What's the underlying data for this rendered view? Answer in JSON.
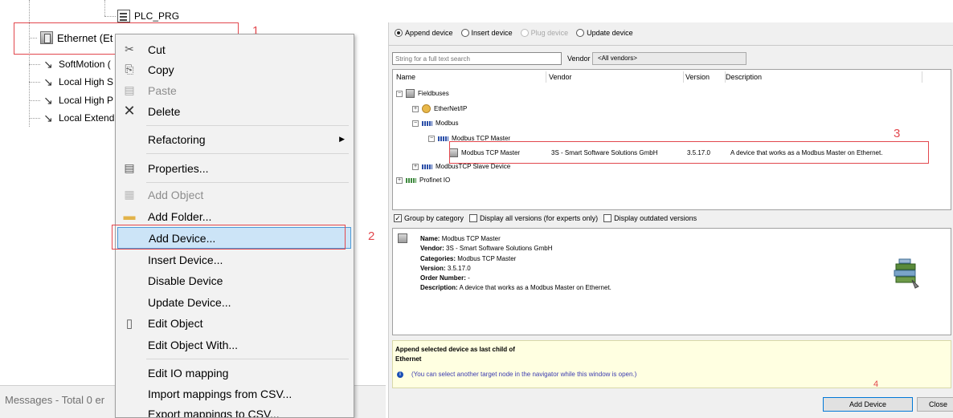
{
  "tree": {
    "plc_prg": "PLC_PRG",
    "items": [
      {
        "label": "Ethernet (Et",
        "icon": "ethernet-icon"
      },
      {
        "label": "SoftMotion (",
        "icon": "axis-icon"
      },
      {
        "label": "Local High S",
        "icon": "axis-icon"
      },
      {
        "label": "Local High P",
        "icon": "axis-icon"
      },
      {
        "label": "Local Extend",
        "icon": "axis-icon"
      }
    ]
  },
  "messages": "Messages - Total 0 er",
  "annotations": {
    "n1": "1",
    "n2": "2",
    "n3": "3",
    "n4": "4",
    "color": "#e2474d"
  },
  "context_menu": {
    "cut": "Cut",
    "copy": "Copy",
    "paste": "Paste",
    "delete": "Delete",
    "refactoring": "Refactoring",
    "properties": "Properties...",
    "add_object": "Add Object",
    "add_folder": "Add Folder...",
    "add_device": "Add Device...",
    "insert_device": "Insert Device...",
    "disable_device": "Disable Device",
    "update_device": "Update Device...",
    "edit_object": "Edit Object",
    "edit_object_with": "Edit Object With...",
    "edit_io_mapping": "Edit IO mapping",
    "import_csv": "Import mappings from CSV...",
    "export_csv": "Export mappings to CSV..."
  },
  "dialog": {
    "modes": {
      "append": "Append device",
      "insert": "Insert device",
      "plug": "Plug device",
      "update": "Update device",
      "selected": "append"
    },
    "search_placeholder": "String for a full text search",
    "vendor_label": "Vendor",
    "vendor_value": "<All vendors>",
    "columns": {
      "name": "Name",
      "vendor": "Vendor",
      "version": "Version",
      "description": "Description"
    },
    "tree": {
      "fieldbuses": "Fieldbuses",
      "ethernetip": "EtherNet/IP",
      "modbus": "Modbus",
      "modbus_tcp_master_group": "Modbus TCP Master",
      "selected_row": {
        "name": "Modbus TCP Master",
        "vendor": "3S - Smart Software Solutions GmbH",
        "version": "3.5.17.0",
        "description": "A device that works as a Modbus Master on Ethernet."
      },
      "modbus_tcp_slave": "ModbusTCP Slave Device",
      "profinet": "Profinet IO"
    },
    "options": {
      "group_by_category": "Group by category",
      "group_checked": true,
      "display_all_versions": "Display all versions (for experts only)",
      "display_outdated": "Display outdated versions"
    },
    "info": {
      "name_label": "Name:",
      "name": "Modbus TCP Master",
      "vendor_label": "Vendor:",
      "vendor": "3S - Smart Software Solutions GmbH",
      "categories_label": "Categories:",
      "categories": "Modbus TCP Master",
      "version_label": "Version:",
      "version": "3.5.17.0",
      "order_label": "Order Number:",
      "order": "-",
      "description_label": "Description:",
      "description": "A device that works as a Modbus Master on Ethernet."
    },
    "hint": {
      "line1": "Append selected device as last child of",
      "line2": "Ethernet",
      "line3": "(You can select another target node in the navigator while this window is open.)"
    },
    "buttons": {
      "add_device": "Add Device",
      "close": "Close"
    }
  }
}
